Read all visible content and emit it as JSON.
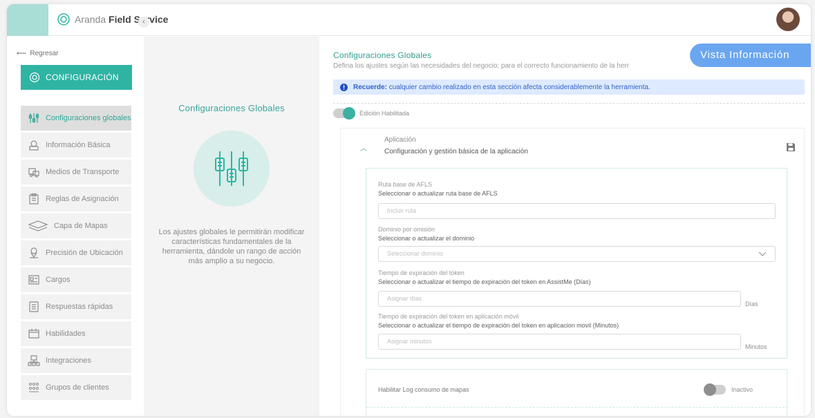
{
  "app": {
    "brand_light": "Aranda",
    "brand_bold": "Field Service",
    "accent": "#2fb4a4"
  },
  "sidebar": {
    "back_label": "Regresar",
    "config_label": "CONFIGURACIÓN",
    "items": [
      {
        "label": "Configuraciones globales",
        "icon": "sliders-icon",
        "active": true
      },
      {
        "label": "Información Básica",
        "icon": "badge-icon"
      },
      {
        "label": "Medios de Transporte",
        "icon": "transport-icon"
      },
      {
        "label": "Reglas de Asignación",
        "icon": "clipboard-icon"
      },
      {
        "label": "Capa de Mapas",
        "icon": "layers-icon"
      },
      {
        "label": "Precisión de Ubicación",
        "icon": "location-icon"
      },
      {
        "label": "Cargos",
        "icon": "id-card-icon"
      },
      {
        "label": "Respuestas rápidas",
        "icon": "document-icon"
      },
      {
        "label": "Habilidades",
        "icon": "calendar-icon"
      },
      {
        "label": "Integraciones",
        "icon": "network-icon"
      },
      {
        "label": "Grupos de clientes",
        "icon": "group-icon"
      }
    ]
  },
  "center": {
    "title": "Configuraciones Globales",
    "description": "Los ajustes globales le permitirán modificar características fundamentales de la herramienta, dándole un rango de acción más amplio a su negocio."
  },
  "main": {
    "title": "Configuraciones Globales",
    "subtitle": "Defina los ajustes según las necesidades del negocio; para el correcto funcionamiento de la herr",
    "vista_label": "Vista Información",
    "notice_strong": "Recuerde:",
    "notice_text": "cualquier cambio realizado en esta sección afecta considerablemente la herramienta.",
    "edit_toggle_label": "Edición Habilitada",
    "section": {
      "title": "Aplicación",
      "subtitle": "Configuración y gestión básica de la aplicación",
      "fields": {
        "ruta_label": "Ruta base de AFLS",
        "ruta_help": "Seleccionar o actualizar ruta base de AFLS",
        "ruta_placeholder": "Incluir ruta",
        "dominio_label": "Dominio por omisión",
        "dominio_help": "Seleccionar o actualizar el dominio",
        "dominio_placeholder": "Seleccionar dominio",
        "token_label": "Tiempo de expiración del token",
        "token_help": "Seleccionar o actualizar el tiempo de expiración del token en AssistMe (Días)",
        "token_placeholder": "Asignar días",
        "token_unit": "Días",
        "token_movil_label": "Tiempo de expiración del token en aplicación móvil",
        "token_movil_help": "Seleccionar o actualizar el tiempo de expiración del token en aplicacion movil (Minutos)",
        "token_movil_placeholder": "Asignar minutos",
        "token_movil_unit": "Minutos"
      },
      "log_label": "Habilitar Log consumo de mapas",
      "log_state": "Inactivo"
    }
  }
}
